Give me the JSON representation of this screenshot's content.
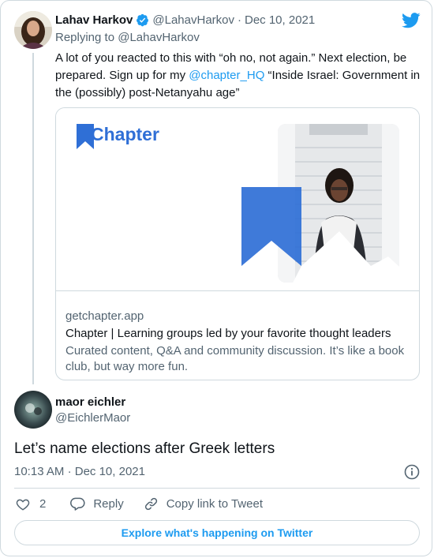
{
  "tweet1": {
    "author_name": "Lahav Harkov",
    "handle": "@LahavHarkov",
    "separator": "·",
    "date": "Dec 10, 2021",
    "replying_label": "Replying to",
    "replying_handle": "@LahavHarkov",
    "text_part1": "A lot of you reacted to this with “oh no, not again.” Next election, be prepared. Sign up for my ",
    "text_mention": "@chapter_HQ",
    "text_part2": " “Inside Israel: Government in the (possibly) post-Netanyahu age”"
  },
  "link_card": {
    "logo_text": "Chapter",
    "domain": "getchapter.app",
    "title": "Chapter | Learning groups led by your favorite thought leaders",
    "description": "Curated content, Q&A and community discussion. It’s like a book club, but way more fun."
  },
  "tweet2": {
    "author_name": "maor eichler",
    "handle": "@EichlerMaor",
    "text": "Let’s name elections after Greek letters",
    "time": "10:13 AM",
    "separator": "·",
    "date": "Dec 10, 2021"
  },
  "actions": {
    "like_count": "2",
    "reply_label": "Reply",
    "copy_link_label": "Copy link to Tweet"
  },
  "footer": {
    "explore_label": "Explore what's happening on Twitter"
  },
  "colors": {
    "twitter_blue": "#1d9bf0",
    "chapter_blue": "#2f6fd6",
    "text": "#0f1419",
    "muted": "#536471",
    "border": "#cfd9de"
  },
  "icons": [
    "twitter-bird-icon",
    "verified-badge-icon",
    "info-icon",
    "heart-icon",
    "reply-icon",
    "link-icon"
  ]
}
